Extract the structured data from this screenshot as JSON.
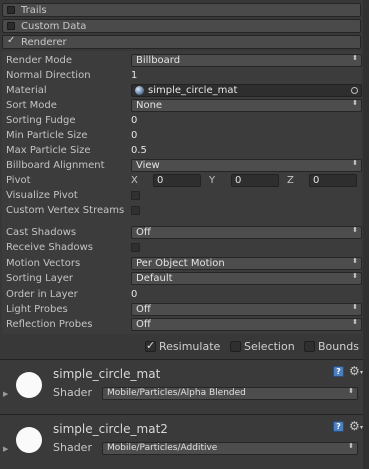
{
  "modules": [
    {
      "label": "Trails",
      "enabled": false
    },
    {
      "label": "Custom Data",
      "enabled": false
    },
    {
      "label": "Renderer",
      "enabled": true,
      "check": "✓"
    }
  ],
  "renderer": {
    "render_mode": {
      "label": "Render Mode",
      "value": "Billboard"
    },
    "normal_direction": {
      "label": "Normal Direction",
      "value": "1"
    },
    "material": {
      "label": "Material",
      "value": "simple_circle_mat"
    },
    "sort_mode": {
      "label": "Sort Mode",
      "value": "None"
    },
    "sorting_fudge": {
      "label": "Sorting Fudge",
      "value": "0"
    },
    "min_particle_size": {
      "label": "Min Particle Size",
      "value": "0"
    },
    "max_particle_size": {
      "label": "Max Particle Size",
      "value": "0.5"
    },
    "billboard_alignment": {
      "label": "Billboard Alignment",
      "value": "View"
    },
    "pivot": {
      "label": "Pivot",
      "x_label": "X",
      "x": "0",
      "y_label": "Y",
      "y": "0",
      "z_label": "Z",
      "z": "0"
    },
    "visualize_pivot": {
      "label": "Visualize Pivot",
      "checked": false
    },
    "custom_vertex_streams": {
      "label": "Custom Vertex Streams",
      "checked": false
    },
    "cast_shadows": {
      "label": "Cast Shadows",
      "value": "Off"
    },
    "receive_shadows": {
      "label": "Receive Shadows",
      "checked": false
    },
    "motion_vectors": {
      "label": "Motion Vectors",
      "value": "Per Object Motion"
    },
    "sorting_layer": {
      "label": "Sorting Layer",
      "value": "Default"
    },
    "order_in_layer": {
      "label": "Order in Layer",
      "value": "0"
    },
    "light_probes": {
      "label": "Light Probes",
      "value": "Off"
    },
    "reflection_probes": {
      "label": "Reflection Probes",
      "value": "Off"
    }
  },
  "toggles": {
    "resimulate": {
      "label": "Resimulate",
      "checked": true,
      "check": "✓"
    },
    "selection": {
      "label": "Selection",
      "checked": false
    },
    "bounds": {
      "label": "Bounds",
      "checked": false
    }
  },
  "materials": [
    {
      "name": "simple_circle_mat",
      "shader_label": "Shader",
      "shader": "Mobile/Particles/Alpha Blended"
    },
    {
      "name": "simple_circle_mat2",
      "shader_label": "Shader",
      "shader": "Mobile/Particles/Additive"
    }
  ],
  "icons": {
    "dropdown": "⬍",
    "help": "?",
    "gear": "⚙",
    "gear_arrow": "▾",
    "foldout": "▶"
  }
}
